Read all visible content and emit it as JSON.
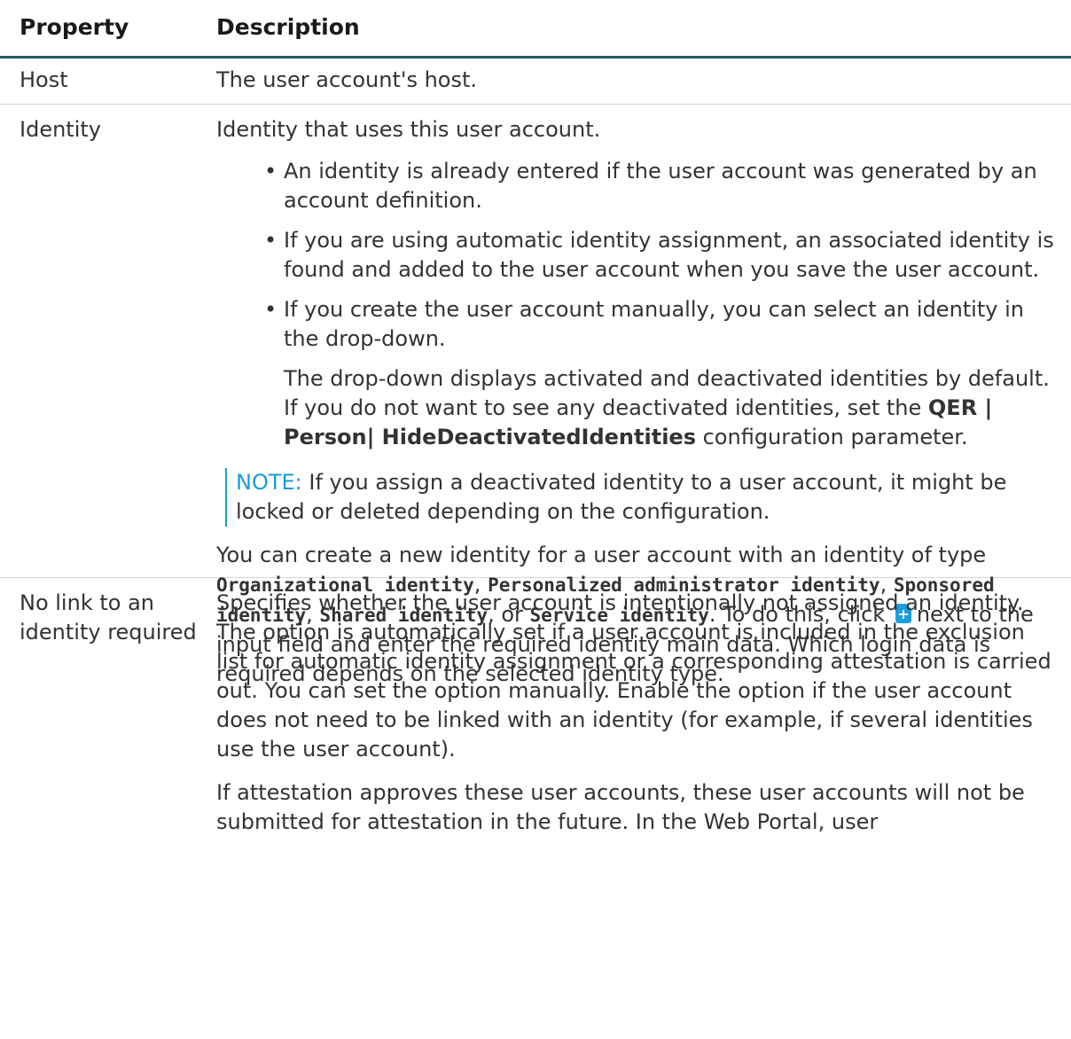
{
  "table": {
    "headers": {
      "property": "Property",
      "description": "Description"
    },
    "rows": [
      {
        "property": "Host",
        "description": "The user account's host."
      },
      {
        "property": "Identity",
        "intro": "Identity that uses this user account.",
        "bullets": [
          "An identity is already entered if the user account was generated by an account definition.",
          "If you are using automatic identity assignment, an associated identity is found and added to the user account when you save the user account.",
          "If you create the user account manually, you can select an identity in the drop-down."
        ],
        "dropdown_note_a": "The drop-down displays activated and deactivated identities by default. If you do not want to see any deactivated identities, set the ",
        "dropdown_note_param": "QER | Person| HideDeactivatedIdentities",
        "dropdown_note_b": " configuration parameter.",
        "note_label": "NOTE:",
        "note_text": " If you assign a deactivated identity to a user account, it might be locked or deleted depending on the configuration.",
        "create_a": "You can create a new identity for a user account with an identity of type ",
        "type_1": "Organizational identity",
        "sep_1": ", ",
        "type_2": "Personalized administrator identity",
        "sep_2": ", ",
        "type_3": "Sponsored identity",
        "sep_3": ", ",
        "type_4": "Shared identity",
        "sep_4": ", or ",
        "type_5": "Service identity",
        "create_b": ". To do this, click",
        "create_c": "next to the input field and enter the required identity main data. Which login data is required depends on the selected identity type."
      },
      {
        "property": "No link to an identity required",
        "p1": "Specifies whether the user account is intentionally not assigned an identity. The option is automatically set if a user account is included in the exclusion list for automatic identity assignment or a corresponding attestation is carried out. You can set the option manually. Enable the option if the user account does not need to be linked with an identity (for example, if several identities use the user account).",
        "p2": "If attestation approves these user accounts, these user accounts will not be submitted for attestation in the future. In the Web Portal, user"
      }
    ]
  }
}
